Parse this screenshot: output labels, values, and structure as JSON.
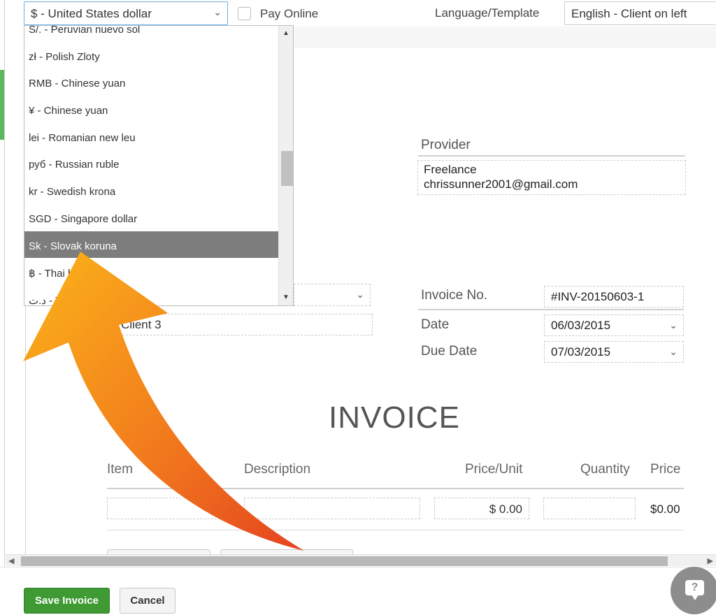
{
  "toolbar": {
    "currency_selected": "$ - United States dollar",
    "pay_online_label": "Pay Online",
    "pay_online_checked": false,
    "language_label": "Language/Template",
    "language_selected": "English - Client on left"
  },
  "currency_dropdown": {
    "items": [
      "S/. - Peruvian nuevo sol",
      "zł - Polish Zloty",
      "RMB - Chinese yuan",
      "¥ - Chinese yuan",
      "lei - Romanian new leu",
      "руб - Russian ruble",
      "kr - Swedish krona",
      "SGD - Singapore dollar",
      "Sk - Slovak koruna",
      "฿ - Thai baht",
      "د.ت - Tunisian dinar"
    ],
    "highlighted": "Sk - Slovak koruna"
  },
  "invoice": {
    "provider_label": "Provider",
    "provider_name": "Freelance",
    "provider_email": "chrissunner2001@gmail.com",
    "client_field": "Client 3",
    "invoice_no_label": "Invoice No.",
    "invoice_no": "#INV-20150603-1",
    "date_label": "Date",
    "date": "06/03/2015",
    "due_date_label": "Due Date",
    "due_date": "07/03/2015",
    "title": "INVOICE",
    "columns": [
      "Item",
      "Description",
      "Price/Unit",
      "Quantity",
      "Price"
    ],
    "row": {
      "price_unit": "$ 0.00",
      "price": "$0.00"
    }
  },
  "footer": {
    "save_label": "Save Invoice",
    "cancel_label": "Cancel",
    "help_glyph": "?"
  },
  "colors": {
    "save_green": "#3f9a34",
    "selected_row": "#7d7d7d",
    "arrow_orange": "#f5a21b",
    "arrow_red": "#e64a1f"
  }
}
